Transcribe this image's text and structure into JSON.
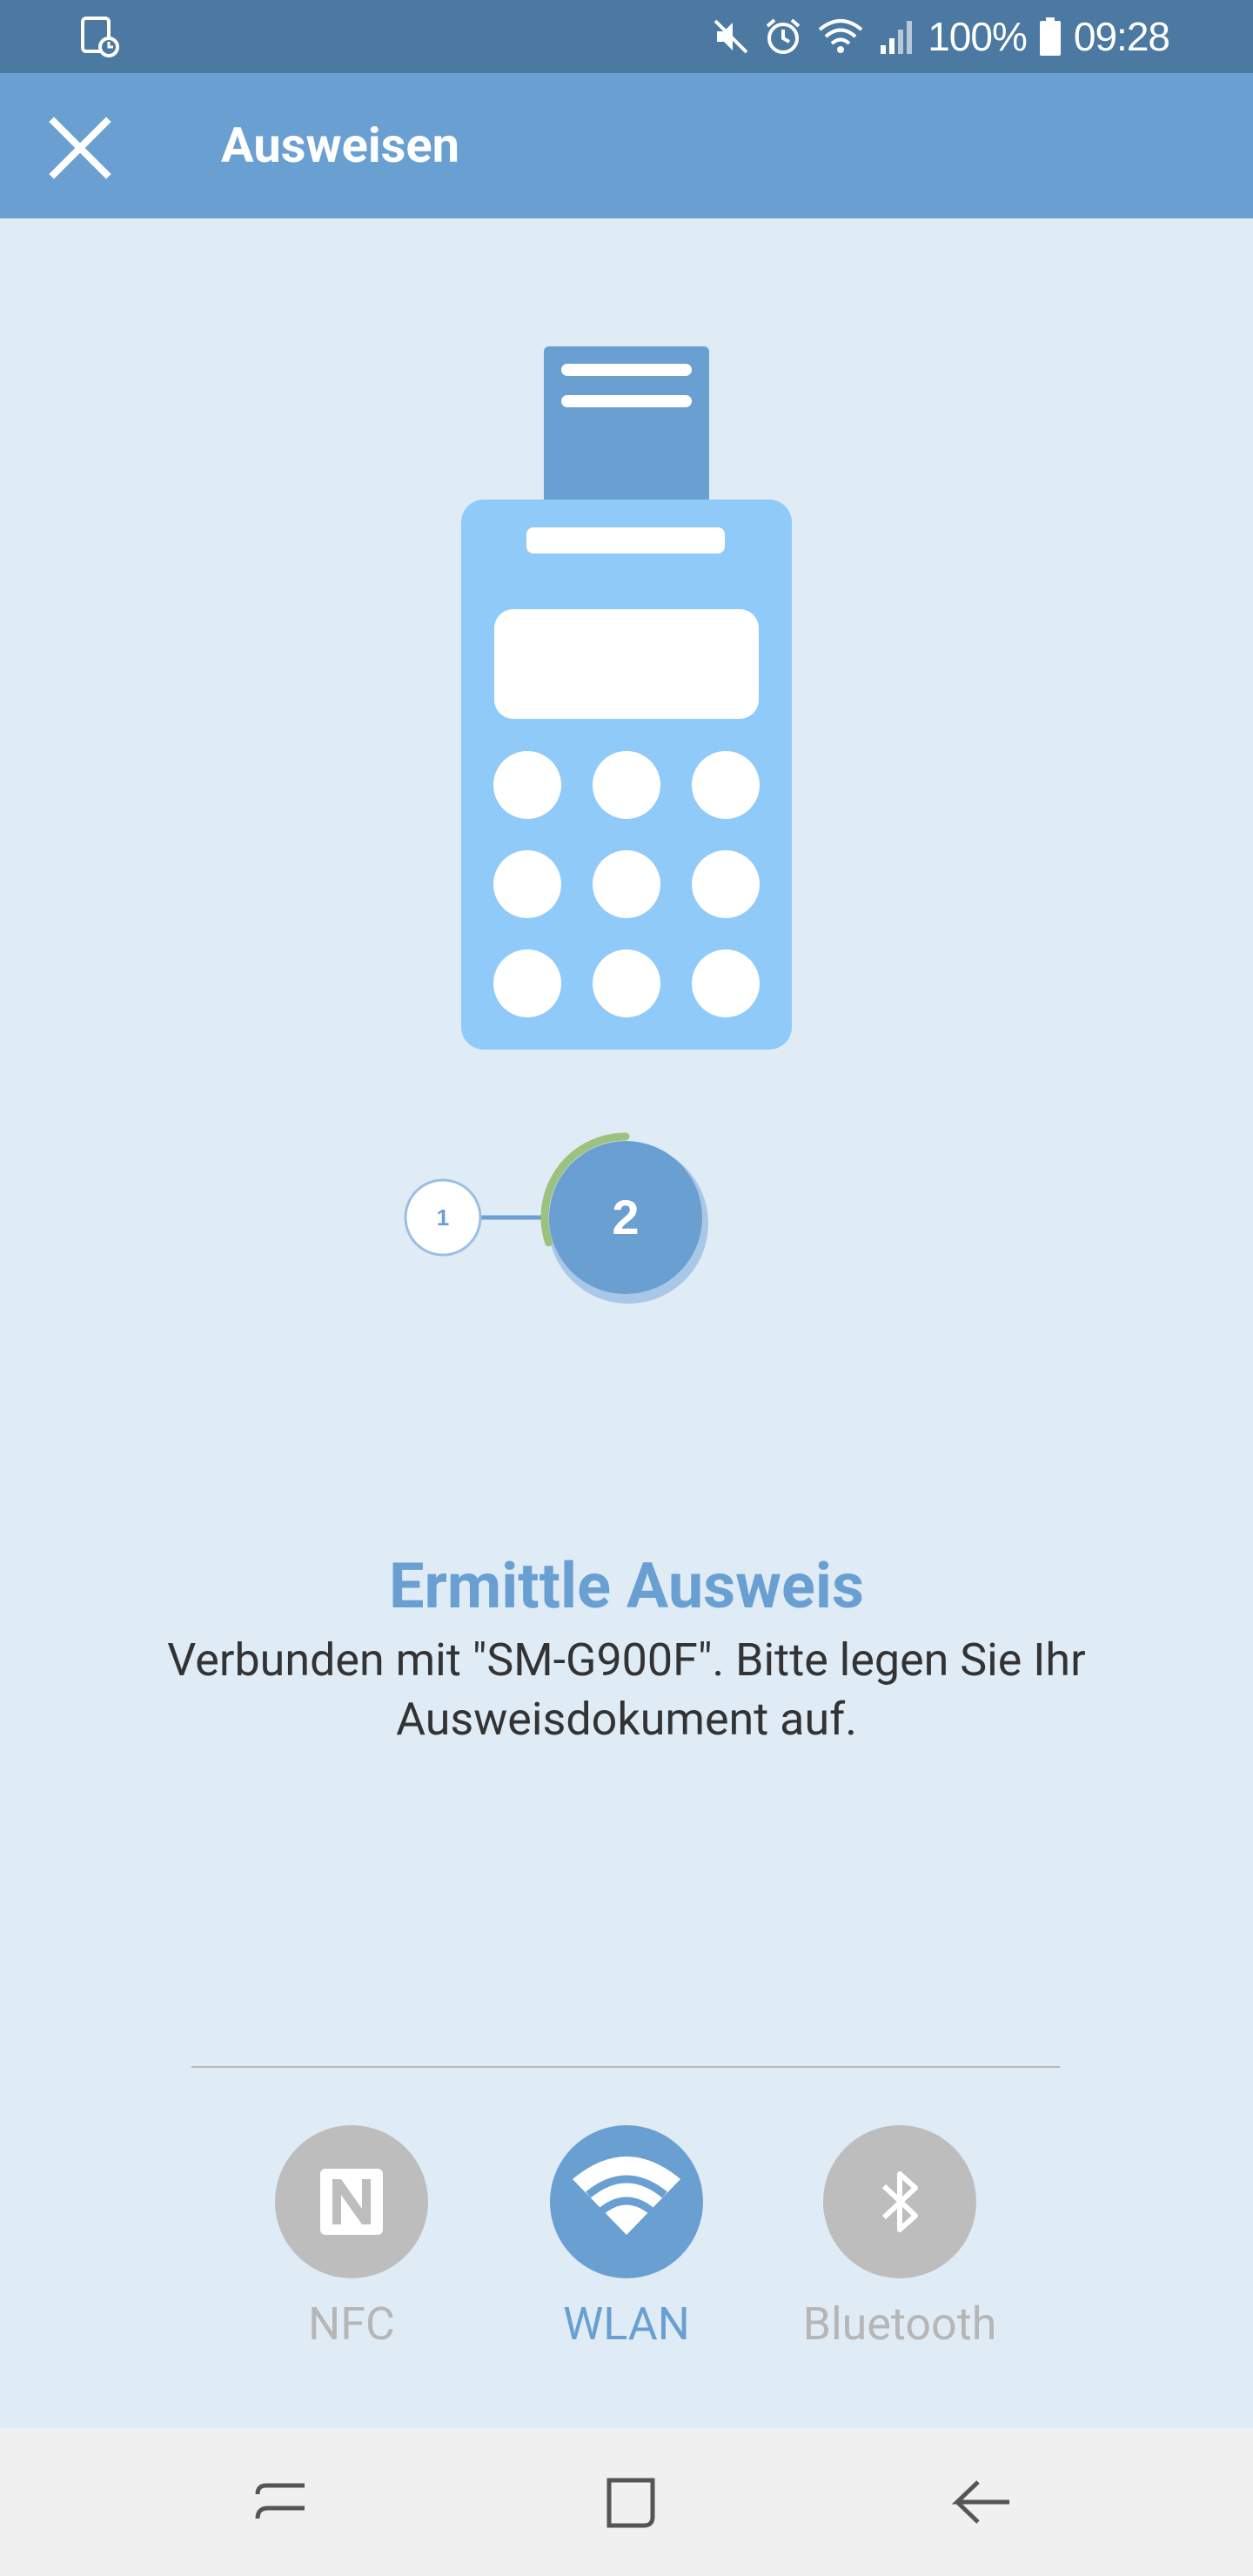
{
  "status_bar": {
    "battery_percent": "100%",
    "time": "09:28",
    "icons": [
      "screenshot-notification-icon",
      "mute-icon",
      "alarm-icon",
      "wifi-icon",
      "signal-icon",
      "battery-icon"
    ]
  },
  "app_bar": {
    "title": "Ausweisen",
    "close_icon": "close-icon"
  },
  "stepper": {
    "step1": "1",
    "step2": "2",
    "current_step": 2,
    "progress_fraction": 0.3
  },
  "main": {
    "heading": "Ermittle Ausweis",
    "description": "Verbunden mit \"SM-G900F\". Bitte legen Sie Ihr Ausweisdokument auf."
  },
  "connection_options": [
    {
      "label": "NFC",
      "icon": "nfc-icon",
      "active": false
    },
    {
      "label": "WLAN",
      "icon": "wifi-icon",
      "active": true
    },
    {
      "label": "Bluetooth",
      "icon": "bluetooth-icon",
      "active": false
    }
  ],
  "colors": {
    "accent": "#6a9fd2",
    "status_bar": "#4b79a1",
    "background": "#dfecf6",
    "progress": "#9cc27f",
    "inactive": "#bdbdbd"
  },
  "nav_bar": {
    "icons": [
      "recents-icon",
      "home-icon",
      "back-icon"
    ]
  }
}
